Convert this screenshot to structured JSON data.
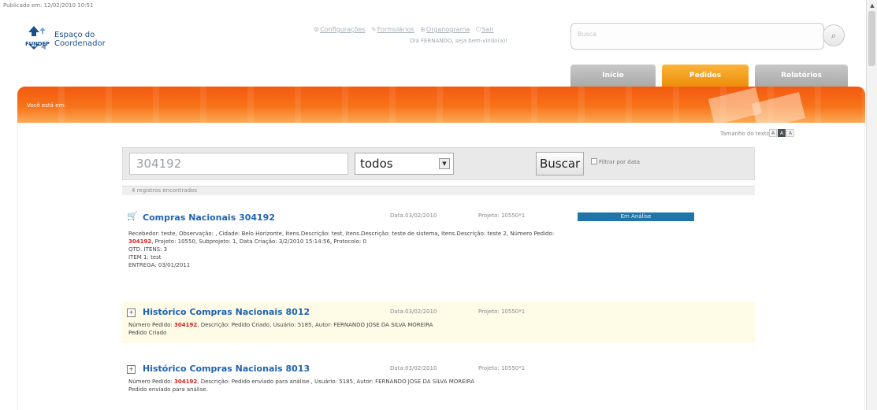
{
  "header": {
    "published": "Publicado em: 12/02/2010 10:51",
    "brand": "FUNDEP",
    "product_line1": "Espaço do",
    "product_line2": "Coordenador",
    "links": [
      "Configurações",
      "Formulários",
      "Organograma",
      "Sair"
    ],
    "greeting": "Olá FERNANDO, seja bem-vindo(a)!",
    "search_placeholder": "Busca"
  },
  "nav": {
    "tabs": [
      "Início",
      "Pedidos",
      "Relatórios"
    ],
    "active": "Pedidos"
  },
  "breadcrumb": "Você está em:",
  "text_size": {
    "label": "Tamanho do texto",
    "options": [
      "A",
      "A",
      "A"
    ]
  },
  "search": {
    "query": "304192",
    "type_selected": "todos",
    "button": "Buscar",
    "filter_label": "Filtrar por data"
  },
  "results_count": "4 registros encontrados",
  "results": [
    {
      "title": "Compras Nacionais 304192",
      "date": "Data:03/02/2010",
      "project": "Projeto: 10550*1",
      "status": "Em Análise",
      "body1": "Recebedor: teste, Observação: , Cidade: Belo Horizonte, Itens.Descrição: test, Itens.Descrição: teste de sistema, Itens.Descrição: teste 2, Número Pedido:",
      "body2_hl": "304192",
      "body2": ", Projeto: 10550, Subprojeto: 1, Data Criação: 3/2/2010 15:14:56, Protocolo: 0",
      "body3": "QTD. ITENS: 3",
      "body4": "ITEM 1: test",
      "body5": "ENTREGA: 03/01/2011"
    },
    {
      "title": "Histórico Compras Nacionais 8012",
      "date": "Data:03/02/2010",
      "project": "Projeto: 10550*1",
      "body1_pre": "Número Pedido: ",
      "body1_hl": "304192",
      "body1": ", Descrição: Pedido Criado, Usuário: 5185, Autor: FERNANDO JOSE DA SILVA MOREIRA",
      "body2": "Pedido Criado"
    },
    {
      "title": "Histórico Compras Nacionais 8013",
      "date": "Data:03/02/2010",
      "project": "Projeto: 10550*1",
      "body1_pre": "Número Pedido: ",
      "body1_hl": "304192",
      "body1": ", Descrição: Pedido enviado para análise., Usuário: 5185, Autor: FERNANDO JOSE DA SILVA MOREIRA",
      "body2": "Pedido enviado para análise."
    }
  ],
  "colors": {
    "brand_orange": "#f35a0f",
    "link_blue": "#1f63b3",
    "status_blue": "#1f74a8",
    "highlight_red": "#d51c1c"
  }
}
